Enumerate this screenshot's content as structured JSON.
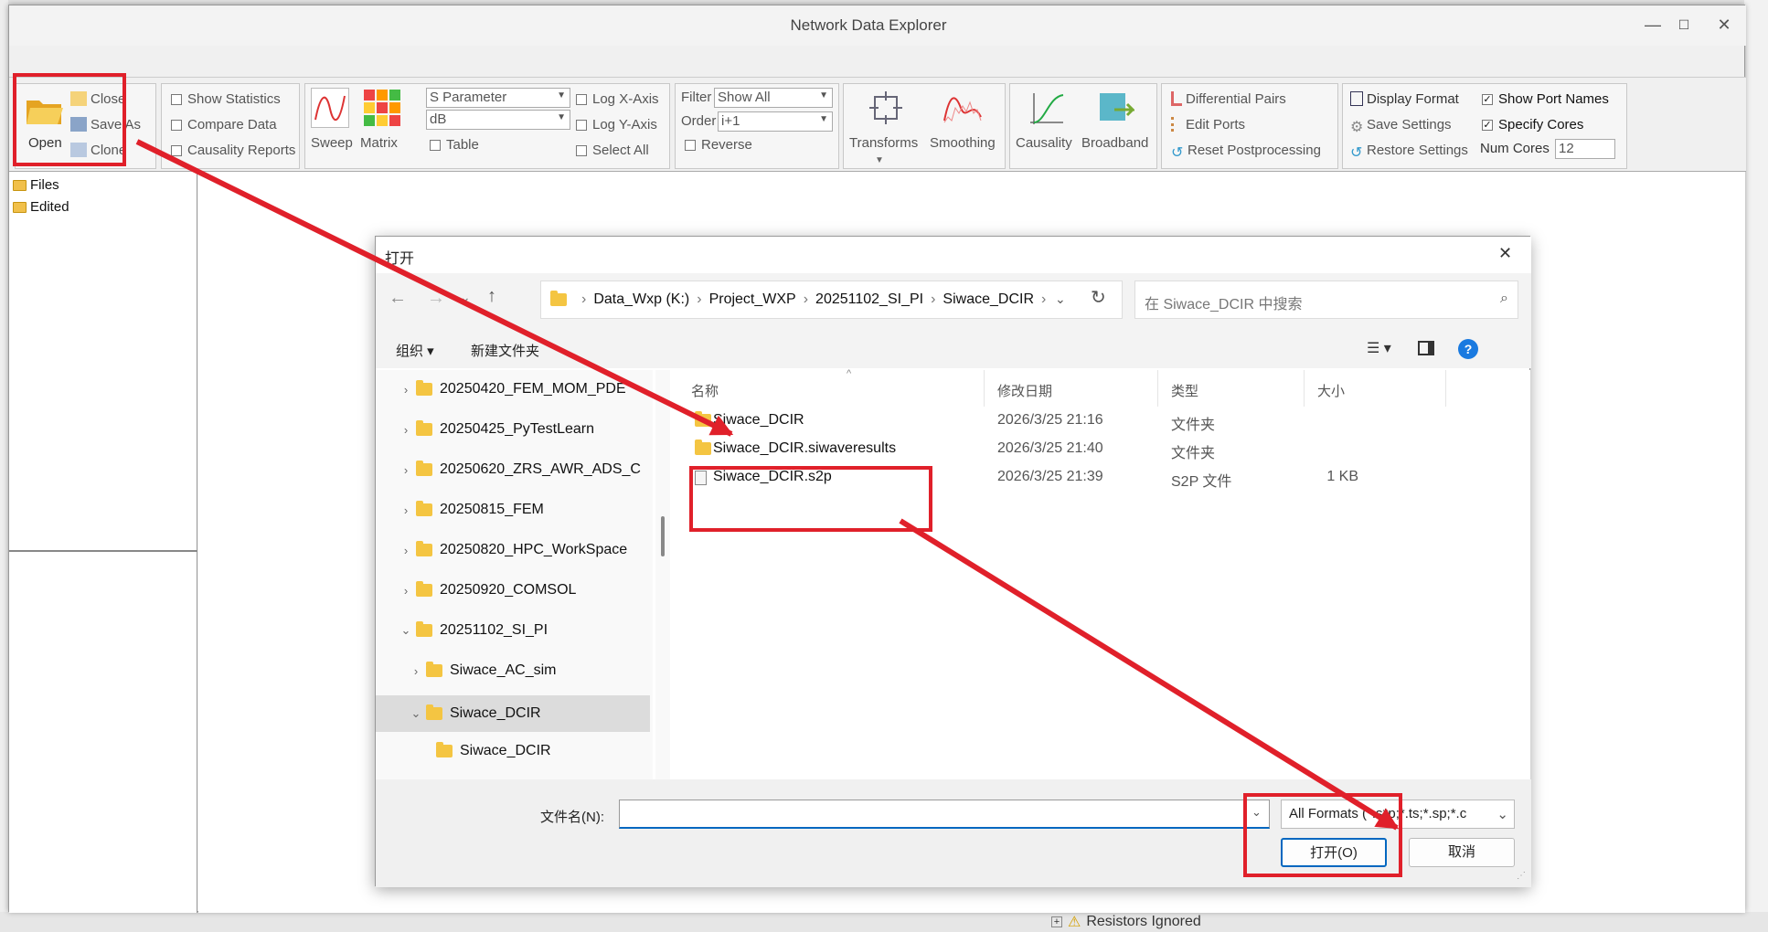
{
  "window": {
    "title": "Network Data Explorer",
    "min": "—",
    "max": "☐",
    "close": "✕"
  },
  "ribbon": {
    "open": "Open",
    "close": "Close",
    "save_as": "Save As",
    "clone": "Clone",
    "show_statistics": "Show Statistics",
    "compare_data": "Compare Data",
    "causality_reports": "Causality Reports",
    "sweep": "Sweep",
    "matrix": "Matrix",
    "param_select": "S Parameter",
    "unit_select": "dB",
    "table": "Table",
    "log_x": "Log X-Axis",
    "log_y": "Log Y-Axis",
    "select_all": "Select All",
    "filter_label": "Filter",
    "filter_value": "Show All",
    "order_label": "Order",
    "order_value": "i+1",
    "reverse": "Reverse",
    "transforms": "Transforms",
    "smoothing": "Smoothing",
    "causality": "Causality",
    "broadband": "Broadband",
    "differential_pairs": "Differential Pairs",
    "edit_ports": "Edit Ports",
    "reset_post": "Reset Postprocessing",
    "display_format": "Display Format",
    "save_settings": "Save Settings",
    "restore_settings": "Restore Settings",
    "show_port_names": "Show Port Names",
    "specify_cores": "Specify Cores",
    "num_cores_label": "Num Cores",
    "num_cores_value": "12"
  },
  "tree": {
    "files": "Files",
    "edited": "Edited"
  },
  "background": {
    "resistors": "Resistors Ignored"
  },
  "dialog": {
    "title": "打开",
    "breadcrumb": [
      "Data_Wxp (K:)",
      "Project_WXP",
      "20251102_SI_PI",
      "Siwace_DCIR"
    ],
    "search_placeholder": "在 Siwace_DCIR 中搜索",
    "organize": "组织 ▾",
    "new_folder": "新建文件夹",
    "nav": [
      "20250420_FEM_MOM_PDE",
      "20250425_PyTestLearn",
      "20250620_ZRS_AWR_ADS_C",
      "20250815_FEM",
      "20250820_HPC_WorkSpace",
      "20250920_COMSOL",
      "20251102_SI_PI",
      "Siwace_AC_sim",
      "Siwace_DCIR",
      "Siwace_DCIR"
    ],
    "columns": {
      "name": "名称",
      "date": "修改日期",
      "type": "类型",
      "size": "大小"
    },
    "files": [
      {
        "name": "Siwace_DCIR",
        "date": "2026/3/25 21:16",
        "type": "文件夹",
        "size": ""
      },
      {
        "name": "Siwace_DCIR.siwaveresults",
        "date": "2026/3/25 21:40",
        "type": "文件夹",
        "size": ""
      },
      {
        "name": "Siwace_DCIR.s2p",
        "date": "2026/3/25 21:39",
        "type": "S2P 文件",
        "size": "1 KB"
      }
    ],
    "filename_label": "文件名(N):",
    "filename_value": "",
    "filter": "All Formats  (*.s*p;*.ts;*.sp;*.c",
    "open_button": "打开(O)",
    "cancel_button": "取消"
  },
  "colors": {
    "accent": "#0067c0",
    "annotation": "#e0202a"
  }
}
